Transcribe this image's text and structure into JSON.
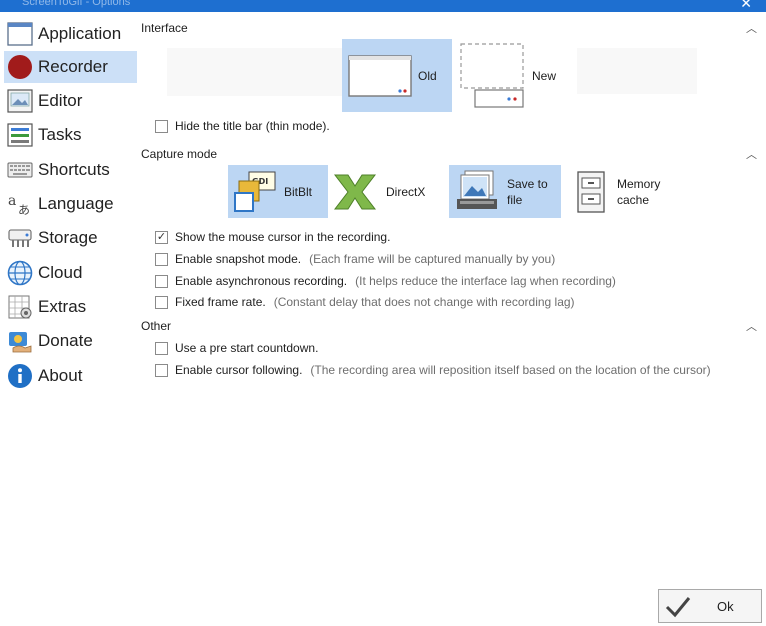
{
  "window": {
    "title": "ScreenToGif - Options",
    "close_glyph": "✕"
  },
  "sidebar": {
    "items": [
      {
        "label": "Application",
        "icon": "application-window-icon",
        "selected": false
      },
      {
        "label": "Recorder",
        "icon": "record-circle-icon",
        "selected": true
      },
      {
        "label": "Editor",
        "icon": "image-editor-icon",
        "selected": false
      },
      {
        "label": "Tasks",
        "icon": "tasks-list-icon",
        "selected": false
      },
      {
        "label": "Shortcuts",
        "icon": "keyboard-icon",
        "selected": false
      },
      {
        "label": "Language",
        "icon": "language-icon",
        "selected": false
      },
      {
        "label": "Storage",
        "icon": "storage-drive-icon",
        "selected": false
      },
      {
        "label": "Cloud",
        "icon": "cloud-globe-icon",
        "selected": false
      },
      {
        "label": "Extras",
        "icon": "extras-icon",
        "selected": false
      },
      {
        "label": "Donate",
        "icon": "donate-icon",
        "selected": false
      },
      {
        "label": "About",
        "icon": "info-icon",
        "selected": false
      }
    ]
  },
  "interface": {
    "header": "Interface",
    "options": [
      {
        "label": "Old",
        "selected": true
      },
      {
        "label": "New",
        "selected": false
      }
    ],
    "hide_title_bar": {
      "label": "Hide the title bar (thin mode).",
      "checked": false
    }
  },
  "capture_mode": {
    "header": "Capture mode",
    "options": [
      {
        "label": "BitBlt",
        "selected": true
      },
      {
        "label": "DirectX",
        "selected": false
      },
      {
        "label": "Save to file",
        "selected": true
      },
      {
        "label": "Memory cache",
        "selected": false
      }
    ],
    "gdi_label": "GDI",
    "checks": [
      {
        "label": "Show the mouse cursor in the recording.",
        "hint": "",
        "checked": true
      },
      {
        "label": "Enable snapshot mode.",
        "hint": "(Each frame will be captured manually by you)",
        "checked": false
      },
      {
        "label": "Enable asynchronous recording.",
        "hint": "(It helps reduce the interface lag when recording)",
        "checked": false
      },
      {
        "label": "Fixed frame rate.",
        "hint": "(Constant delay that does not change with recording lag)",
        "checked": false
      }
    ]
  },
  "other": {
    "header": "Other",
    "checks": [
      {
        "label": "Use a pre start countdown.",
        "hint": "",
        "checked": false
      },
      {
        "label": "Enable cursor following.",
        "hint": "(The recording area will reposition itself based on the location of the cursor)",
        "checked": false
      }
    ]
  },
  "footer": {
    "ok_label": "Ok"
  },
  "colors": {
    "accent": "#1e6fd0",
    "selection": "#cce0f7",
    "tile_selection": "#bcd6f3",
    "hint_text": "#6e6e6e"
  }
}
